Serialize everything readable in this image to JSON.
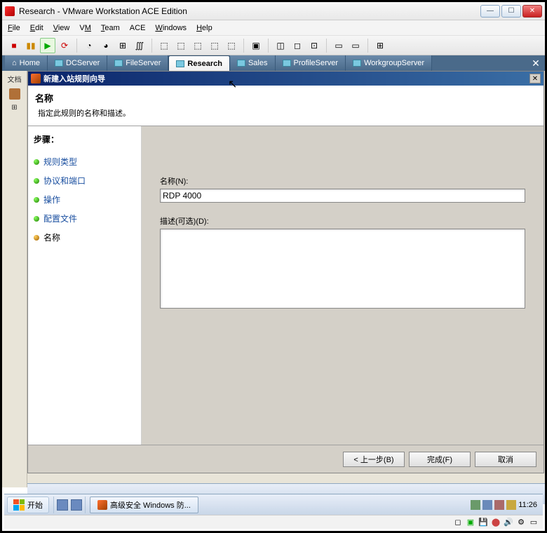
{
  "window": {
    "title": "Research - VMware Workstation ACE Edition"
  },
  "menu": {
    "file": "File",
    "edit": "Edit",
    "view": "View",
    "vm": "VM",
    "team": "Team",
    "ace": "ACE",
    "windows": "Windows",
    "help": "Help"
  },
  "vmtabs": [
    {
      "label": "Home"
    },
    {
      "label": "DCServer"
    },
    {
      "label": "FileServer"
    },
    {
      "label": "Research",
      "active": true
    },
    {
      "label": "Sales"
    },
    {
      "label": "ProfileServer"
    },
    {
      "label": "WorkgroupServer"
    }
  ],
  "leftThumb": {
    "label": "文档"
  },
  "wizard": {
    "windowTitle": "新建入站规则向导",
    "headerTitle": "名称",
    "headerDesc": "指定此规则的名称和描述。",
    "stepsTitle": "步骤：",
    "steps": [
      {
        "label": "规则类型"
      },
      {
        "label": "协议和端口"
      },
      {
        "label": "操作"
      },
      {
        "label": "配置文件"
      },
      {
        "label": "名称",
        "current": true
      }
    ],
    "nameLabel": "名称(N):",
    "nameValue": "RDP 4000",
    "descLabel": "描述(可选)(D):",
    "descValue": "",
    "btnBack": "< 上一步(B)",
    "btnFinish": "完成(F)",
    "btnCancel": "取消"
  },
  "taskbar": {
    "start": "开始",
    "task1": "高级安全 Windows 防...",
    "clock": "11:26"
  }
}
